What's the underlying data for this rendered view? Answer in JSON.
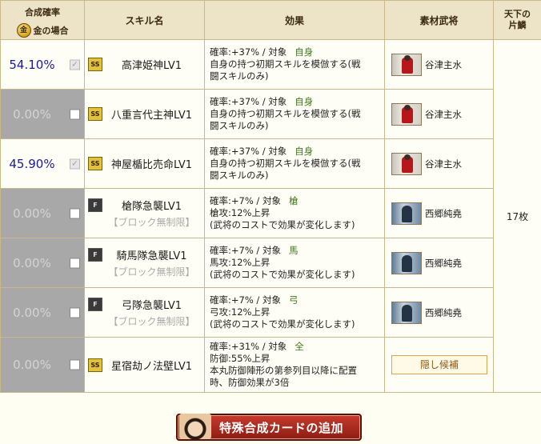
{
  "header": {
    "rate_title": "合成確率",
    "gold_label": "金の場合",
    "gold_icon": "金",
    "skill_col": "スキル名",
    "effect_col": "効果",
    "material_col": "素材武将",
    "fragment_col_line1": "天下の",
    "fragment_col_line2": "片鱗"
  },
  "fragment_count": "17枚",
  "rows": [
    {
      "rate": "54.10%",
      "active": true,
      "badge": "SS",
      "name": "高津姫神LV1",
      "note": "",
      "eff1": "確率:+37% / 対象",
      "target": "自身",
      "eff2": "自身の持つ初期スキルを模倣する(戦",
      "eff3": "闘スキルのみ)",
      "material": "谷津主水",
      "portrait": "red"
    },
    {
      "rate": "0.00%",
      "active": false,
      "badge": "SS",
      "name": "八重言代主神LV1",
      "note": "",
      "eff1": "確率:+37% / 対象",
      "target": "自身",
      "eff2": "自身の持つ初期スキルを模倣する(戦",
      "eff3": "闘スキルのみ)",
      "material": "谷津主水",
      "portrait": "red"
    },
    {
      "rate": "45.90%",
      "active": true,
      "badge": "SS",
      "name": "神屋楯比売命LV1",
      "note": "",
      "eff1": "確率:+37% / 対象",
      "target": "自身",
      "eff2": "自身の持つ初期スキルを模倣する(戦",
      "eff3": "闘スキルのみ)",
      "material": "谷津主水",
      "portrait": "red"
    },
    {
      "rate": "0.00%",
      "active": false,
      "badge": "F",
      "name": "槍隊急襲LV1",
      "note": "【ブロック無制限】",
      "eff1": "確率:+7% / 対象",
      "target": "槍",
      "eff2": "槍攻:12%上昇",
      "eff3": "(武将のコストで効果が変化します)",
      "material": "西郷純堯",
      "portrait": "blue"
    },
    {
      "rate": "0.00%",
      "active": false,
      "badge": "F",
      "name": "騎馬隊急襲LV1",
      "note": "【ブロック無制限】",
      "eff1": "確率:+7% / 対象",
      "target": "馬",
      "eff2": "馬攻:12%上昇",
      "eff3": "(武将のコストで効果が変化します)",
      "material": "西郷純堯",
      "portrait": "blue"
    },
    {
      "rate": "0.00%",
      "active": false,
      "badge": "F",
      "name": "弓隊急襲LV1",
      "note": "【ブロック無制限】",
      "eff1": "確率:+7% / 対象",
      "target": "弓",
      "eff2": "弓攻:12%上昇",
      "eff3": "(武将のコストで効果が変化します)",
      "material": "西郷純堯",
      "portrait": "blue"
    },
    {
      "rate": "0.00%",
      "active": false,
      "badge": "SS",
      "name": "星宿劫ノ法壁LV1",
      "note": "",
      "eff1": "確率:+31% / 対象",
      "target": "全",
      "eff2": "防御:55%上昇",
      "eff3": "本丸防御陣形の第参列目以降に配置",
      "eff4": "時、防御効果が3倍",
      "material": "",
      "hidden_btn": "隠し候補"
    }
  ],
  "add_card_label": "特殊合成カードの追加",
  "colors": {
    "active_rate": "#1a1a9c",
    "inactive_bg": "#a8a8a8",
    "target_green": "#3d7a1b",
    "button_red": "#c53b2d"
  }
}
